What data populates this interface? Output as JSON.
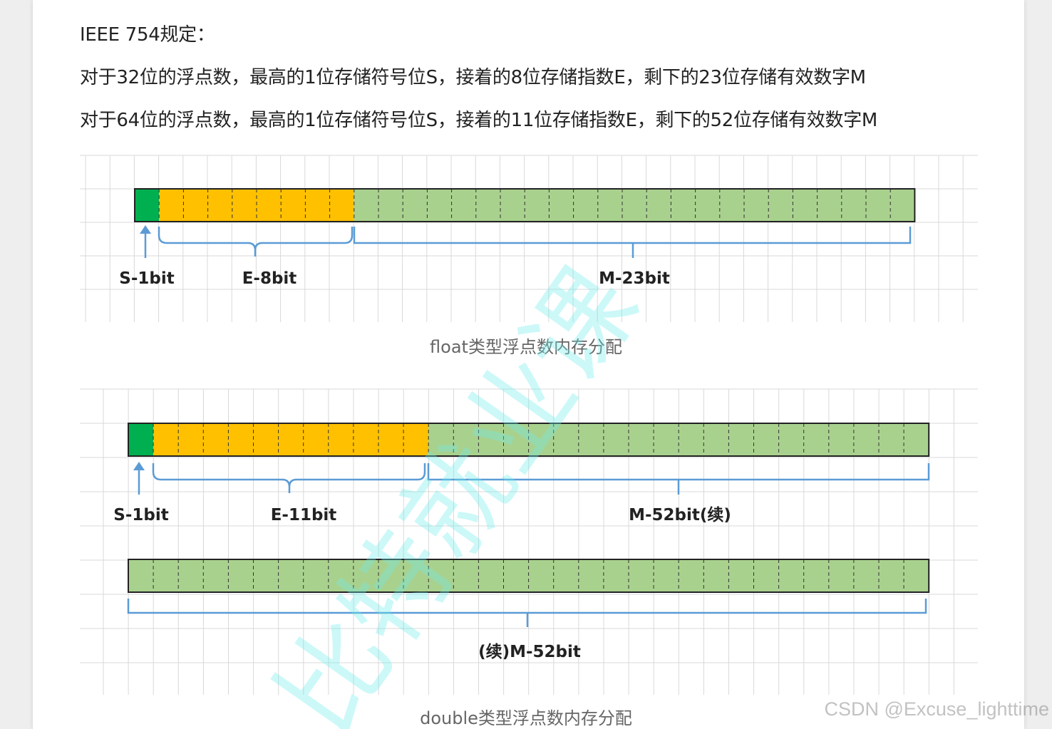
{
  "intro": {
    "line1": "IEEE 754规定：",
    "line2": "对于32位的浮点数，最高的1位存储符号位S，接着的8位存储指数E，剩下的23位存储有效数字M",
    "line3": "对于64位的浮点数，最高的1位存储符号位S，接着的11位存储指数E，剩下的52位存储有效数字M"
  },
  "figure1": {
    "labels": {
      "sign": "S-1bit",
      "exponent": "E-8bit",
      "mantissa": "M-23bit"
    },
    "caption": "float类型浮点数内存分配",
    "bits": {
      "sign": 1,
      "exponent": 8,
      "mantissa": 23
    }
  },
  "figure2": {
    "labels": {
      "sign": "S-1bit",
      "exponent": "E-11bit",
      "mantissa": "M-52bit(续)",
      "continued": "(续)M-52bit"
    },
    "caption": "double类型浮点数内存分配",
    "bits": {
      "sign": 1,
      "exponent": 11,
      "mantissa_row1": 20,
      "mantissa_row2": 32
    }
  },
  "colors": {
    "sign": "#00b050",
    "exponent": "#ffc000",
    "mantissa": "#a9d18e",
    "brace": "#5b9bd5",
    "grid": "#d9d9d9"
  },
  "watermark": {
    "overlay": "比特就业课",
    "credit": "CSDN @Excuse_lighttime"
  }
}
